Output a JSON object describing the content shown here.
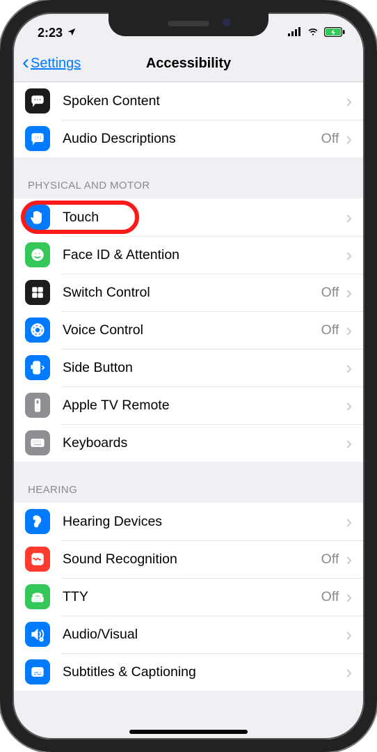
{
  "status_bar": {
    "time": "2:23"
  },
  "nav": {
    "back_label": "Settings",
    "title": "Accessibility"
  },
  "top_group": [
    {
      "key": "spoken-content",
      "label": "Spoken Content",
      "value": "",
      "color": "c-dark",
      "icon": "speech"
    },
    {
      "key": "audio-descriptions",
      "label": "Audio Descriptions",
      "value": "Off",
      "color": "c-blue",
      "icon": "quote"
    }
  ],
  "sections": [
    {
      "header": "PHYSICAL AND MOTOR",
      "items": [
        {
          "key": "touch",
          "label": "Touch",
          "value": "",
          "color": "c-blue",
          "icon": "hand",
          "highlight": true
        },
        {
          "key": "faceid",
          "label": "Face ID & Attention",
          "value": "",
          "color": "c-green",
          "icon": "face"
        },
        {
          "key": "switch-control",
          "label": "Switch Control",
          "value": "Off",
          "color": "c-dark",
          "icon": "grid"
        },
        {
          "key": "voice-control",
          "label": "Voice Control",
          "value": "Off",
          "color": "c-blue",
          "icon": "voice"
        },
        {
          "key": "side-button",
          "label": "Side Button",
          "value": "",
          "color": "c-blue",
          "icon": "side"
        },
        {
          "key": "appletv",
          "label": "Apple TV Remote",
          "value": "",
          "color": "c-gray",
          "icon": "remote"
        },
        {
          "key": "keyboards",
          "label": "Keyboards",
          "value": "",
          "color": "c-gray",
          "icon": "keyboard"
        }
      ]
    },
    {
      "header": "HEARING",
      "items": [
        {
          "key": "hearing-devices",
          "label": "Hearing Devices",
          "value": "",
          "color": "c-blue",
          "icon": "ear"
        },
        {
          "key": "sound-recog",
          "label": "Sound Recognition",
          "value": "Off",
          "color": "c-red",
          "icon": "wave"
        },
        {
          "key": "tty",
          "label": "TTY",
          "value": "Off",
          "color": "c-green",
          "icon": "tty"
        },
        {
          "key": "audio-visual",
          "label": "Audio/Visual",
          "value": "",
          "color": "c-blue",
          "icon": "av"
        },
        {
          "key": "subtitles",
          "label": "Subtitles & Captioning",
          "value": "",
          "color": "c-blue",
          "icon": "cc"
        }
      ]
    }
  ]
}
